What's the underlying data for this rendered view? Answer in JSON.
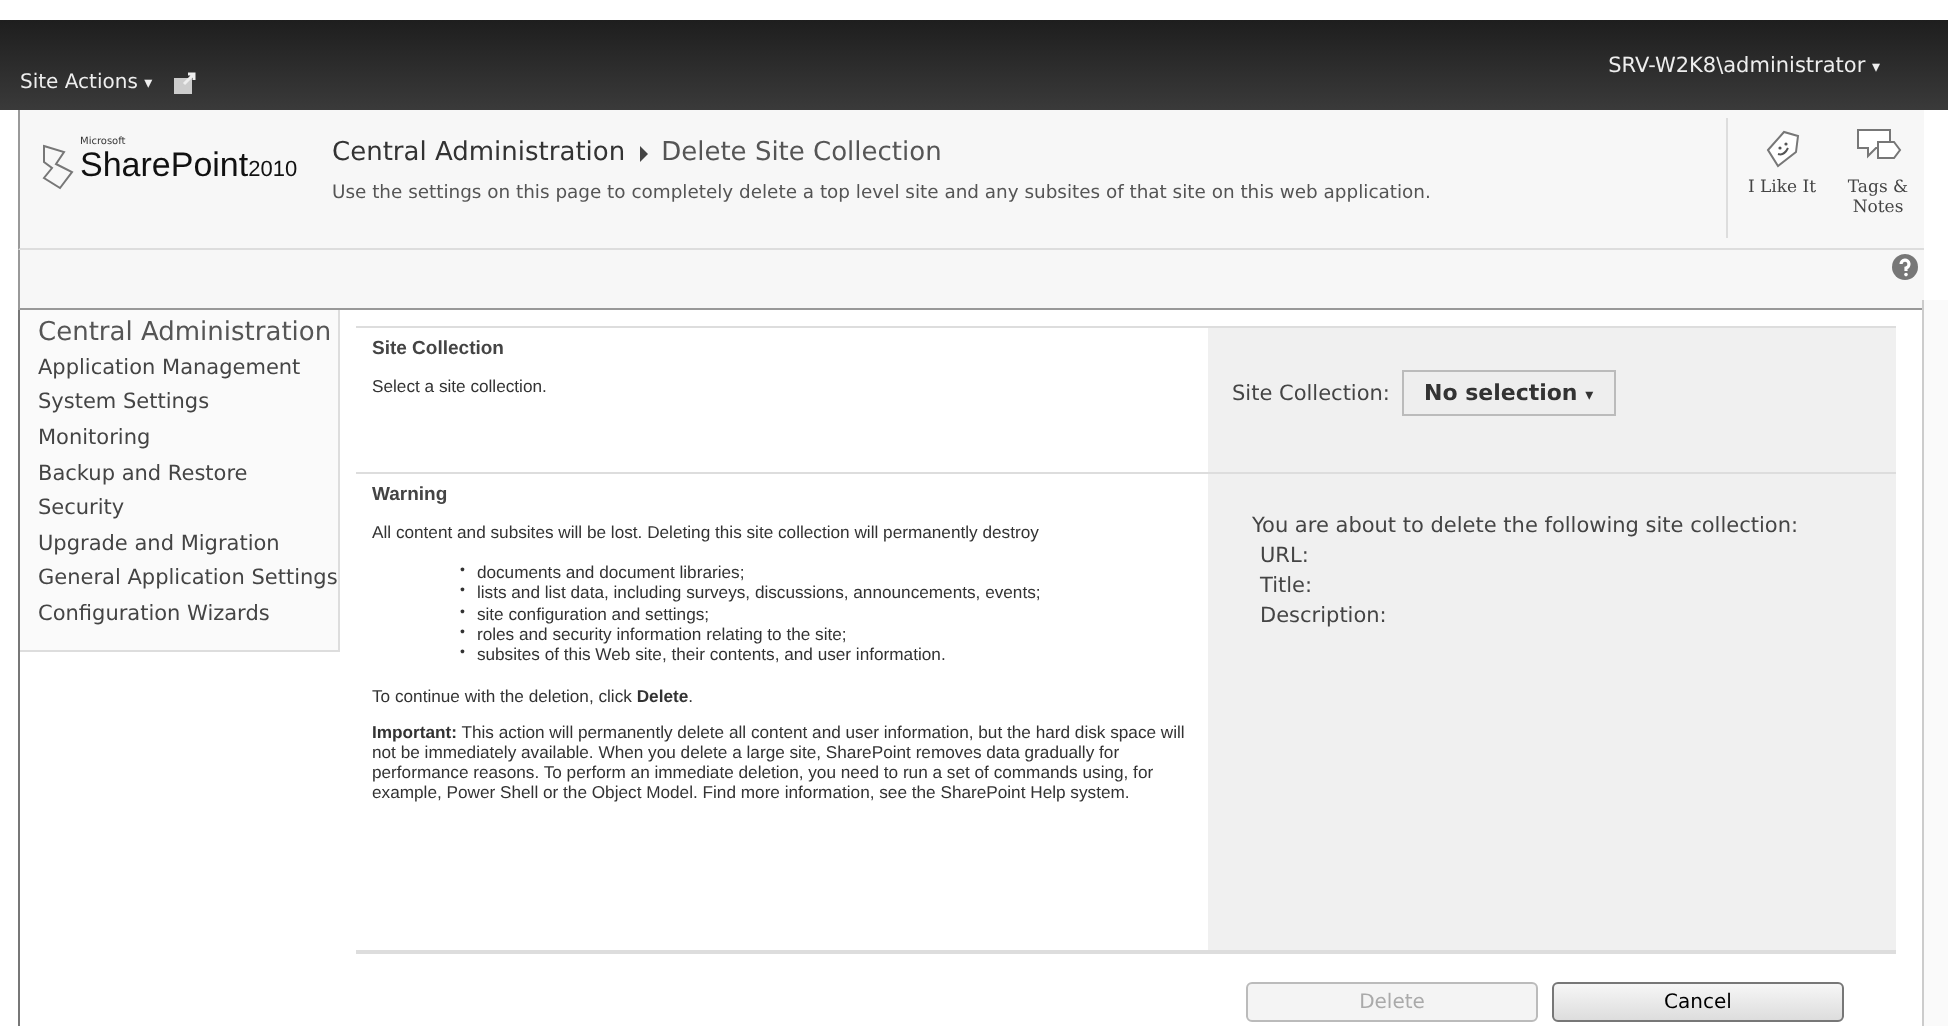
{
  "top_bar": {
    "site_actions": "Site Actions",
    "site_actions_caret": "▾",
    "user": "SRV-W2K8\\administrator",
    "user_caret": "▾"
  },
  "header": {
    "logo_small": "Microsoft",
    "logo": "SharePoint",
    "logo_version": "2010",
    "breadcrumb": [
      "Central Administration",
      "Delete Site Collection"
    ],
    "description": "Use the settings on this page to completely delete a top level site and any subsites of that site on this web application.",
    "social": [
      {
        "kind": "like",
        "label": "I Like It"
      },
      {
        "kind": "tags",
        "label": "Tags & Notes"
      }
    ]
  },
  "sidebar": {
    "title": "Central Administration",
    "items": [
      "Application Management",
      "System Settings",
      "Monitoring",
      "Backup and Restore",
      "Security",
      "Upgrade and Migration",
      "General Application Settings",
      "Configuration Wizards"
    ]
  },
  "sections": [
    {
      "kind": "select",
      "title": "Site Collection",
      "text": "Select a site collection.",
      "field_label": "Site Collection:",
      "dropdown": "No selection",
      "dropdown_caret": "▾"
    },
    {
      "kind": "warning",
      "title": "Warning",
      "text": "All content and subsites will be lost. Deleting this site collection will permanently destroy",
      "bullet": "•",
      "bullets": [
        "documents and document libraries;",
        "lists and list data, including surveys, discussions, announcements, events;",
        "site configuration and settings;",
        "roles and security information relating to the site;",
        "subsites of this Web site, their contents, and user information."
      ],
      "continue": "To continue with the deletion, click **Delete**.",
      "important": "**Important:** This action will permanently delete all content and user information, but the hard disk space will not be immediately available. When you delete a large site, SharePoint removes data gradually for performance reasons. To perform an immediate deletion, you need to run a set of commands using, for example, Power Shell or the Object Model. Find more information, see the SharePoint Help system.",
      "summary": "You are about to delete the following site collection:",
      "fields": [
        "URL:",
        "Title:",
        "Description:"
      ]
    }
  ],
  "buttons": [
    {
      "label": "Delete",
      "disabled": true
    },
    {
      "label": "Cancel",
      "disabled": false
    }
  ]
}
